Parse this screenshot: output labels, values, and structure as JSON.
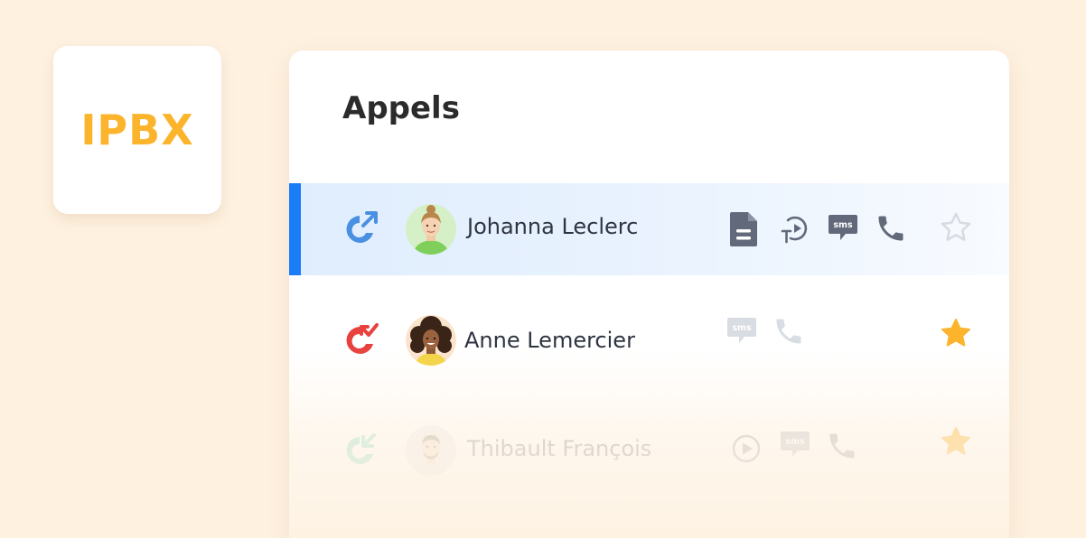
{
  "brand": {
    "label": "IPBX",
    "color": "#fbb42b"
  },
  "panel": {
    "title": "Appels"
  },
  "calls": [
    {
      "name": "Johanna Leclerc",
      "direction": "outgoing",
      "direction_icon": "outgoing-call-icon",
      "direction_color": "#4a90e2",
      "selected": true,
      "favorite": false,
      "actions": [
        "document-icon",
        "transcribe-play-icon",
        "sms-icon",
        "phone-icon"
      ]
    },
    {
      "name": "Anne Lemercier",
      "direction": "missed",
      "direction_icon": "missed-call-icon",
      "direction_color": "#e8423f",
      "selected": false,
      "favorite": true,
      "actions": [
        "sms-icon",
        "phone-icon"
      ]
    },
    {
      "name": "Thibault François",
      "direction": "incoming",
      "direction_icon": "incoming-call-icon",
      "direction_color": "#3cc7a8",
      "selected": false,
      "favorite": true,
      "actions": [
        "play-icon",
        "sms-icon",
        "phone-icon"
      ]
    }
  ],
  "colors": {
    "accent": "#1a7cf6",
    "star": "#fbb42b",
    "background": "#fef1e0"
  }
}
